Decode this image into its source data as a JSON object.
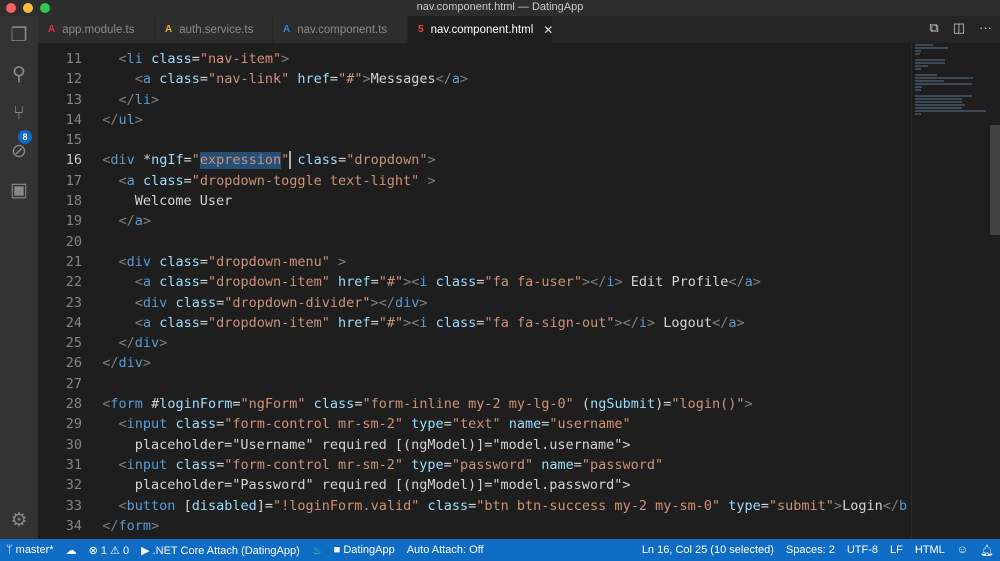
{
  "window": {
    "title": "nav.component.html — DatingApp"
  },
  "activity": {
    "scm_badge": "8"
  },
  "tabs": [
    {
      "label": "app.module.ts",
      "icon": "angular-icon",
      "color": "#e23237"
    },
    {
      "label": "auth.service.ts",
      "icon": "angular-icon",
      "color": "#e3b02c"
    },
    {
      "label": "nav.component.ts",
      "icon": "angular-icon",
      "color": "#2f7fd1"
    },
    {
      "label": "nav.component.html",
      "icon": "html5-icon",
      "color": "#e44d26",
      "active": true,
      "close": "✕"
    }
  ],
  "editor": {
    "current_line": 16,
    "selection": {
      "line": 16,
      "text": "expression"
    },
    "lines": [
      {
        "n": 11,
        "text": "    <li class=\"nav-item\">"
      },
      {
        "n": 12,
        "text": "      <a class=\"nav-link\" href=\"#\">Messages</a>"
      },
      {
        "n": 13,
        "text": "    </li>"
      },
      {
        "n": 14,
        "text": "  </ul>"
      },
      {
        "n": 15,
        "text": ""
      },
      {
        "n": 16,
        "text": "  <div *ngIf=\"expression\" class=\"dropdown\">"
      },
      {
        "n": 17,
        "text": "    <a class=\"dropdown-toggle text-light\" >"
      },
      {
        "n": 18,
        "text": "      Welcome User"
      },
      {
        "n": 19,
        "text": "    </a>"
      },
      {
        "n": 20,
        "text": ""
      },
      {
        "n": 21,
        "text": "    <div class=\"dropdown-menu\" >"
      },
      {
        "n": 22,
        "text": "      <a class=\"dropdown-item\" href=\"#\"><i class=\"fa fa-user\"></i> Edit Profile</a>"
      },
      {
        "n": 23,
        "text": "      <div class=\"dropdown-divider\"></div>"
      },
      {
        "n": 24,
        "text": "      <a class=\"dropdown-item\" href=\"#\"><i class=\"fa fa-sign-out\"></i> Logout</a>"
      },
      {
        "n": 25,
        "text": "    </div>"
      },
      {
        "n": 26,
        "text": "  </div>"
      },
      {
        "n": 27,
        "text": ""
      },
      {
        "n": 28,
        "text": "  <form #loginForm=\"ngForm\" class=\"form-inline my-2 my-lg-0\" (ngSubmit)=\"login()\">"
      },
      {
        "n": 29,
        "text": "    <input class=\"form-control mr-sm-2\" type=\"text\" name=\"username\""
      },
      {
        "n": 30,
        "text": "      placeholder=\"Username\" required [(ngModel)]=\"model.username\">"
      },
      {
        "n": 31,
        "text": "    <input class=\"form-control mr-sm-2\" type=\"password\" name=\"password\""
      },
      {
        "n": 32,
        "text": "      placeholder=\"Password\" required [(ngModel)]=\"model.password\">"
      },
      {
        "n": 33,
        "text": "    <button [disabled]=\"!loginForm.valid\" class=\"btn btn-success my-2 my-sm-0\" type=\"submit\">Login</b"
      },
      {
        "n": 34,
        "text": "  </form>"
      }
    ]
  },
  "status": {
    "branch": "master*",
    "errors": "1",
    "warnings": "0",
    "debug": ".NET Core Attach (DatingApp)",
    "folder": "DatingApp",
    "auto_attach": "Auto Attach: Off",
    "position": "Ln 16, Col 25 (10 selected)",
    "spaces": "Spaces: 2",
    "encoding": "UTF-8",
    "eol": "LF",
    "language": "HTML"
  },
  "colors": {
    "statusbar": "#0e6cc4",
    "tag": "#569cd6",
    "attribute": "#9cdcfe",
    "string": "#ce9178"
  }
}
